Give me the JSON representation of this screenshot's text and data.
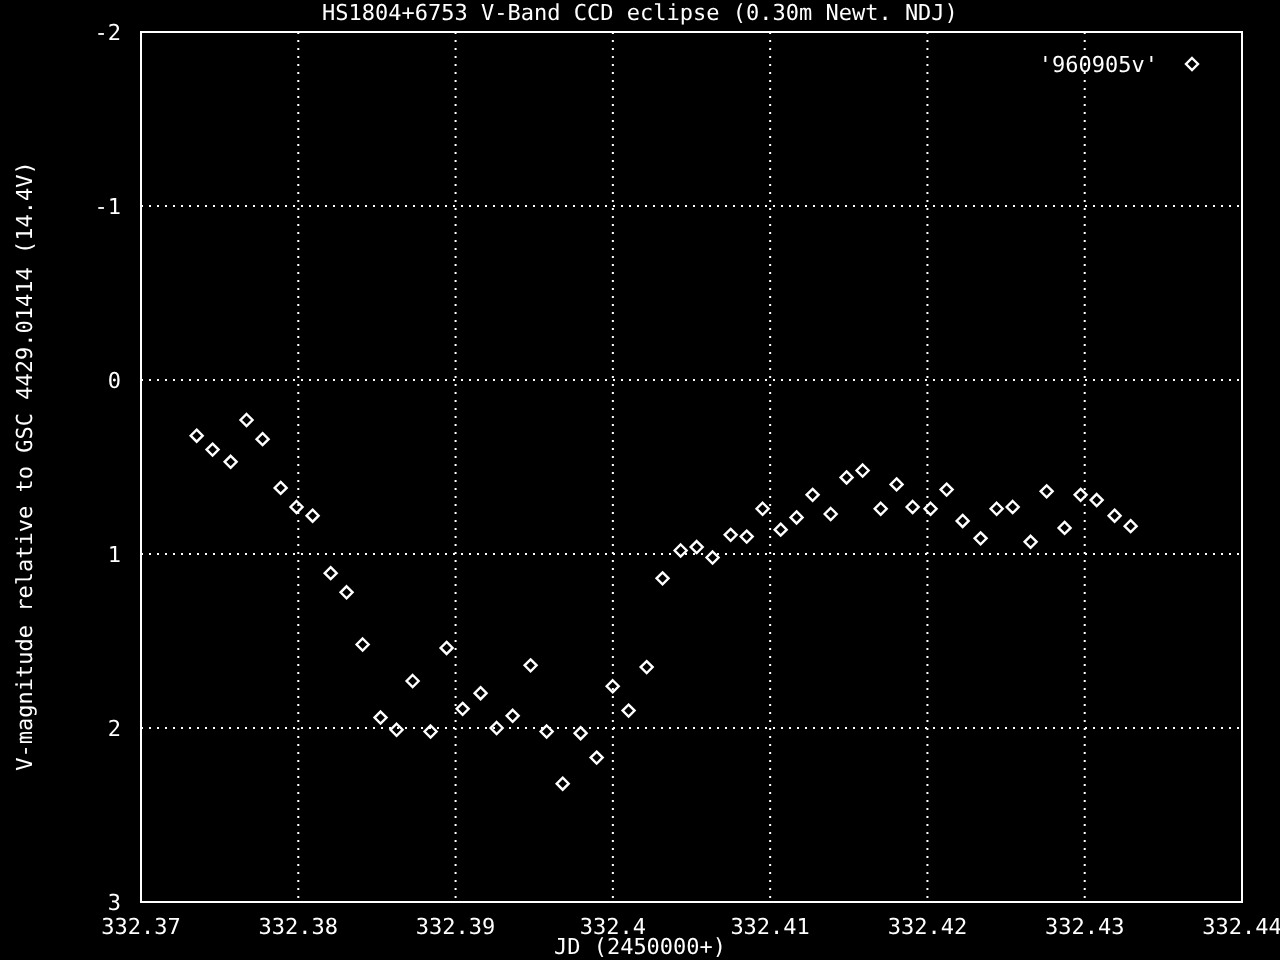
{
  "chart_data": {
    "type": "scatter",
    "title": "HS1804+6753 V-Band CCD eclipse (0.30m Newt. NDJ)",
    "xlabel": "JD (2450000+)",
    "ylabel": "V-magnitude relative to GSC 4429.01414 (14.4V)",
    "grid": true,
    "xlim": [
      332.37,
      332.44
    ],
    "ylim": [
      3,
      -2
    ],
    "xticks": [
      332.37,
      332.38,
      332.39,
      {
        "value": 332.4,
        "label": "332.4"
      },
      332.41,
      332.42,
      332.43,
      332.44
    ],
    "yticks": [
      -2,
      -1,
      0,
      1,
      2,
      3
    ],
    "x": [
      332.37354,
      332.37455,
      332.3757,
      332.37671,
      332.37773,
      332.37888,
      332.37989,
      332.38091,
      332.38206,
      332.38307,
      332.38409,
      332.38523,
      332.38625,
      332.38727,
      332.38841,
      332.38943,
      332.39045,
      332.39159,
      332.39261,
      332.39363,
      332.39477,
      332.39579,
      332.39681,
      332.39795,
      332.39897,
      332.39999,
      332.401,
      332.40215,
      332.40316,
      332.40431,
      332.40533,
      332.40634,
      332.40749,
      332.40851,
      332.40952,
      332.41067,
      332.41168,
      332.4127,
      332.41385,
      332.41486,
      332.41588,
      332.41703,
      332.41804,
      332.41906,
      332.4202,
      332.42122,
      332.42224,
      332.42338,
      332.4244,
      332.42542,
      332.42656,
      332.42758,
      332.42872,
      332.42974,
      332.43076,
      332.4319,
      332.43292
    ],
    "series": [
      {
        "name": "'960905v'",
        "color": "#ffffff",
        "values": [
          0.32,
          0.4,
          0.47,
          0.23,
          0.34,
          0.62,
          0.73,
          0.78,
          1.11,
          1.22,
          1.52,
          1.94,
          2.01,
          1.73,
          2.02,
          1.54,
          1.89,
          1.8,
          2.0,
          1.93,
          1.64,
          2.02,
          2.32,
          2.03,
          2.17,
          1.76,
          1.9,
          1.65,
          1.14,
          0.98,
          0.96,
          1.02,
          0.89,
          0.9,
          0.74,
          0.86,
          0.79,
          0.66,
          0.77,
          0.56,
          0.52,
          0.74,
          0.6,
          0.73,
          0.74,
          0.63,
          0.81,
          0.91,
          0.74,
          0.73,
          0.93,
          0.64,
          0.85,
          0.66,
          0.69,
          0.78,
          0.84
        ]
      }
    ]
  }
}
